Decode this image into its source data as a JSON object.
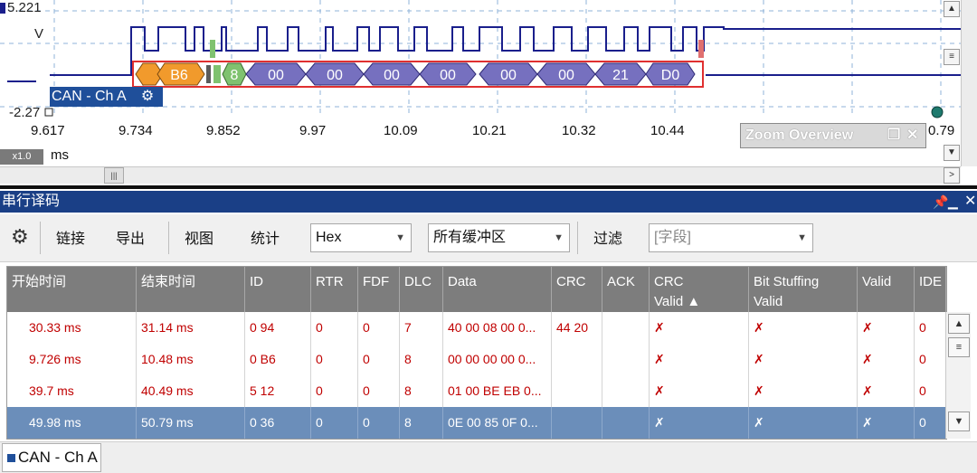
{
  "waveform": {
    "y_max": "5.221",
    "y_unit": "V",
    "y_min": "-2.27",
    "channel_label": "CAN - Ch A",
    "time_ticks": [
      "9.617",
      "9.734",
      "9.852",
      "9.97",
      "10.09",
      "10.21",
      "10.32",
      "10.44",
      "0.79"
    ],
    "time_unit": "ms",
    "zoom_factor": "x1.0",
    "zoom_overview_label": "Zoom Overview",
    "decode_packets": [
      "B6",
      "8",
      "00",
      "00",
      "00",
      "00",
      "00",
      "00",
      "21",
      "D0"
    ],
    "colors": {
      "trace": "#1a1f8c",
      "packet_blue": "#7670bf",
      "packet_orange": "#f19a2c",
      "packet_green": "#7fc26f",
      "frame_red": "#e03030"
    }
  },
  "panel": {
    "title": "串行译码"
  },
  "toolbar": {
    "settings_icon": "gear-icon",
    "link": "链接",
    "export": "导出",
    "view": "视图",
    "stats": "统计",
    "format_value": "Hex",
    "buffer_value": "所有缓冲区",
    "filter": "过滤",
    "field_placeholder": "[字段]"
  },
  "table": {
    "columns": [
      "开始时间",
      "结束时间",
      "ID",
      "RTR",
      "FDF",
      "DLC",
      "Data",
      "CRC",
      "ACK",
      "CRC Valid ▲",
      "Bit Stuffing Valid",
      "Valid",
      "IDE"
    ],
    "rows": [
      [
        "30.33 ms",
        "31.14 ms",
        "0 94",
        "0",
        "0",
        "7",
        "40 00 08 00 0...",
        "44 20",
        "",
        "✗",
        "✗",
        "✗",
        "0"
      ],
      [
        "9.726 ms",
        "10.48 ms",
        "0 B6",
        "0",
        "0",
        "8",
        "00 00 00 00 0...",
        "",
        "",
        "✗",
        "✗",
        "✗",
        "0"
      ],
      [
        "39.7 ms",
        "40.49 ms",
        "5 12",
        "0",
        "0",
        "8",
        "01 00 BE EB 0...",
        "",
        "",
        "✗",
        "✗",
        "✗",
        "0"
      ],
      [
        "49.98 ms",
        "50.79 ms",
        "0 36",
        "0",
        "0",
        "8",
        "0E 00 85 0F 0...",
        "",
        "",
        "✗",
        "✗",
        "✗",
        "0"
      ]
    ],
    "selected_row": 3
  },
  "bottom_tab": "CAN - Ch A"
}
